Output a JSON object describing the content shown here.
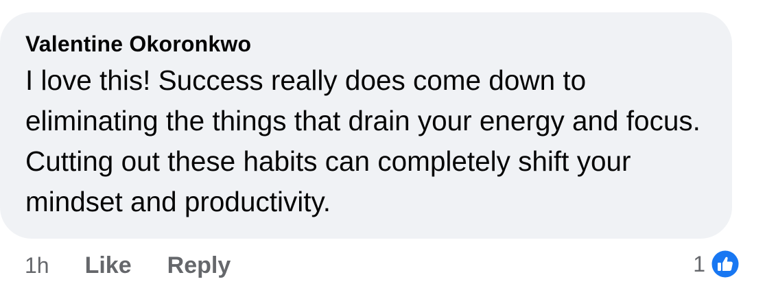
{
  "comment": {
    "author": "Valentine Okoronkwo",
    "text": "I love this! Success really does come down to eliminating the things that drain your energy and focus. Cutting out these habits can completely shift your mindset and productivity.",
    "timestamp": "1h",
    "like_label": "Like",
    "reply_label": "Reply",
    "reaction_count": "1",
    "reaction_icon": "thumbs-up-icon"
  },
  "colors": {
    "bubble_background": "#f0f2f5",
    "primary_text": "#050505",
    "secondary_text": "#65676b",
    "like_blue": "#1877f2"
  }
}
